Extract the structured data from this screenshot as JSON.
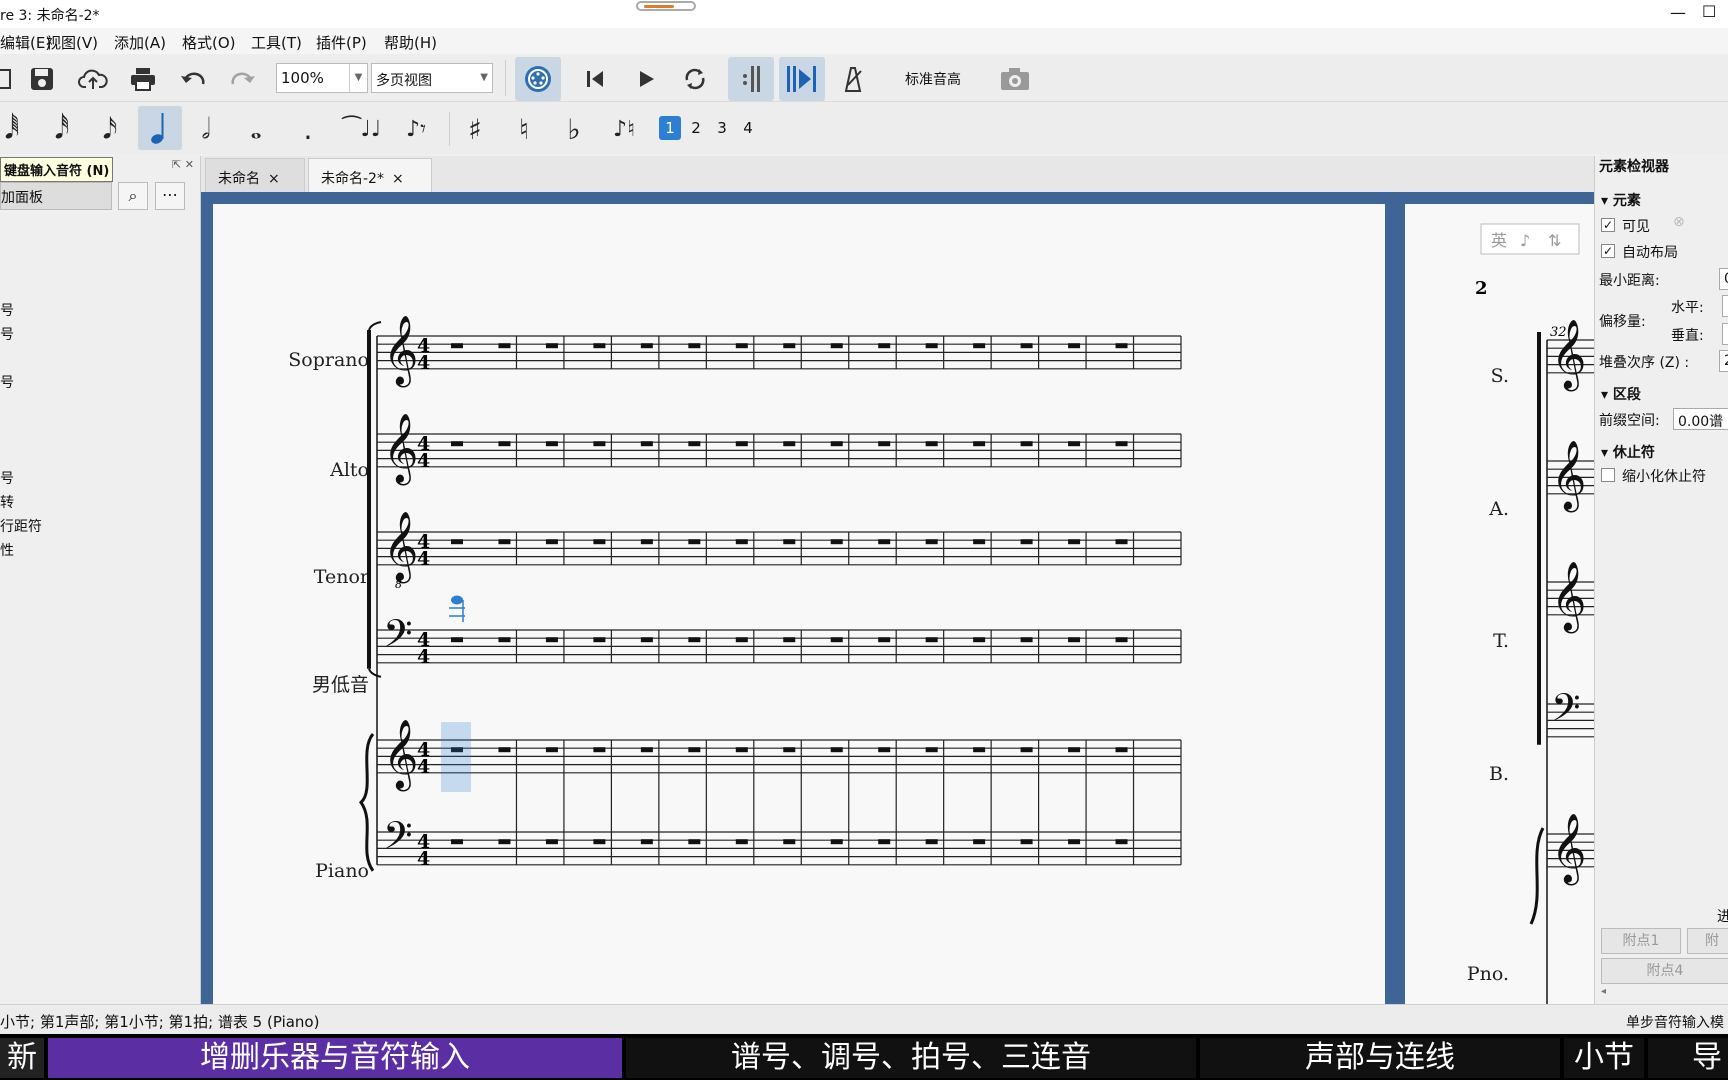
{
  "window": {
    "title": "re 3: 未命名-2*",
    "min_icon": "minimize-icon",
    "max_icon": "maximize-icon"
  },
  "menu": [
    "编辑(E)",
    "视图(V)",
    "添加(A)",
    "格式(O)",
    "工具(T)",
    "插件(P)",
    "帮助(H)"
  ],
  "toolbar": {
    "zoom": "100%",
    "view_mode": "多页视图",
    "pitch_label": "标准音高",
    "icons": [
      "new-file-icon",
      "save-icon",
      "cloud-upload-icon",
      "print-icon",
      "undo-icon",
      "redo-icon",
      "midi-input-icon",
      "rewind-icon",
      "play-icon",
      "loop-icon",
      "count-in-icon",
      "pan-icon",
      "metronome-icon",
      "screenshot-icon"
    ]
  },
  "note_toolbar": {
    "durations": [
      "64th",
      "32nd",
      "16th",
      "eighth",
      "quarter",
      "half",
      "whole",
      "dot"
    ],
    "selected_duration": "quarter",
    "voices": [
      "1",
      "2",
      "3",
      "4"
    ],
    "selected_voice": "1"
  },
  "tooltip": "键盘输入音符 (N)",
  "palette": {
    "search_text": "加面板",
    "items": [
      "号",
      "号",
      "号",
      "号",
      "转",
      "行距符",
      "性"
    ]
  },
  "tabs": [
    {
      "label": "未命名",
      "close": "×"
    },
    {
      "label": "未命名-2*",
      "close": "×"
    }
  ],
  "score": {
    "page1": {
      "staves": [
        {
          "name": "Soprano",
          "clef": "treble"
        },
        {
          "name": "Alto",
          "clef": "treble"
        },
        {
          "name": "Tenor",
          "clef": "treble-8vb"
        },
        {
          "name": "男低音",
          "clef": "bass"
        },
        {
          "name": "Piano",
          "clef": "grand-staff"
        }
      ],
      "time_signature": "4/4",
      "measures": 15
    },
    "page2": {
      "page_number": "2",
      "measure_number": "32",
      "staves": [
        "S.",
        "A.",
        "T.",
        "B.",
        "Pno."
      ]
    },
    "ime_badge": [
      "英",
      "♪",
      "⇅"
    ]
  },
  "inspector": {
    "title": "元素检视器",
    "section_element": "元素",
    "visible": "可见",
    "auto_place": "自动布局",
    "min_distance": "最小距离:",
    "min_distance_value": "0",
    "offset": "偏移量:",
    "horizontal": "水平:",
    "vertical": "垂直:",
    "stacking": "堆叠次序 (Z) :",
    "stacking_value": "2",
    "section_segment": "区段",
    "leading_space": "前缀空间:",
    "leading_space_value": "0.00谱",
    "section_rest": "休止符",
    "small_rest": "缩小化休止符",
    "frag_text": "进",
    "btn_dot1": "附点1",
    "btn_dot2": "附",
    "btn_dot4": "附点4"
  },
  "status": {
    "left": "小节; 第1声部;  第1小节; 第1拍; 谱表 5 (Piano)",
    "right": "单步音符输入模"
  },
  "chapters": [
    "新建",
    "增删乐器与音符输入",
    "谱号、调号、拍号、三连音",
    "声部与连线",
    "小节",
    "导"
  ]
}
